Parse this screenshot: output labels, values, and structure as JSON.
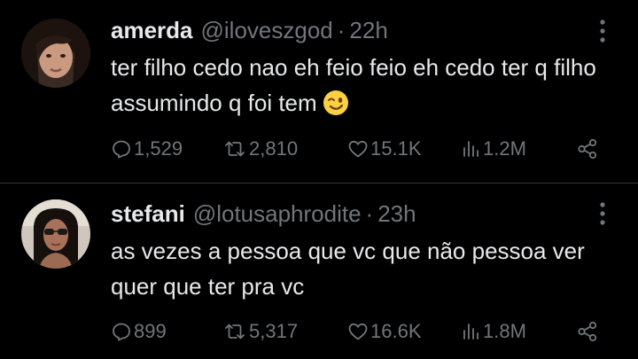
{
  "tweets": [
    {
      "display_name": "amerda",
      "handle": "@iloveszgod",
      "separator": "·",
      "time": "22h",
      "text": "ter filho cedo nao eh feio feio eh cedo ter q filho assumindo q foi tem",
      "emoji": "winking-face",
      "replies": "1,529",
      "retweets": "2,810",
      "likes": "15.1K",
      "views": "1.2M"
    },
    {
      "display_name": "stefani",
      "handle": "@lotusaphrodite",
      "separator": "·",
      "time": "23h",
      "text": "as vezes a pessoa que vc que não pessoa ver quer que ter pra vc",
      "replies": "899",
      "retweets": "5,317",
      "likes": "16.6K",
      "views": "1.8M"
    }
  ],
  "colors": {
    "background": "#000000",
    "primary_text": "#e7e9ea",
    "secondary_text": "#71767b",
    "divider": "#2f3336"
  },
  "icons": [
    "reply-icon",
    "retweet-icon",
    "like-icon",
    "views-icon",
    "share-icon",
    "more-icon"
  ]
}
